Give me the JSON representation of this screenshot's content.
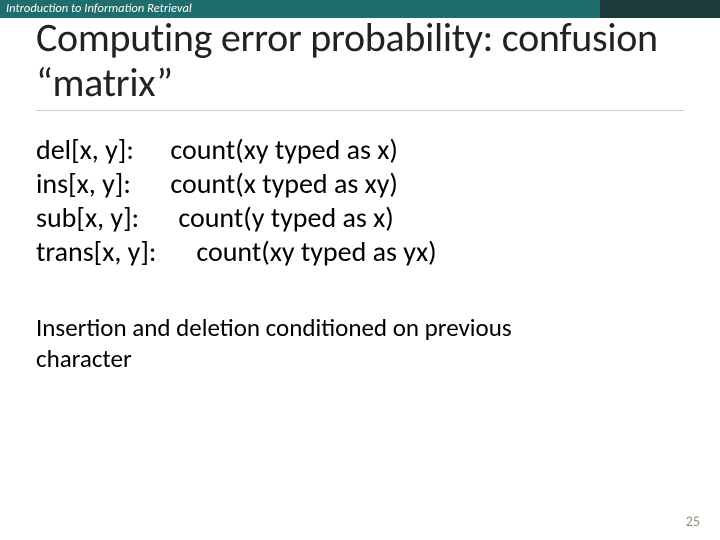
{
  "header": {
    "course_label": "Introduction to Information Retrieval"
  },
  "title": "Computing error probability: confusion “matrix”",
  "definitions": {
    "del": {
      "key": "del[x, y]:",
      "value": "count(xy typed as x)"
    },
    "ins": {
      "key": "ins[x, y]:",
      "value": "count(x typed as xy)"
    },
    "sub": {
      "key": "sub[x, y]:",
      "value": "count(y typed as x)"
    },
    "trans": {
      "key": "trans[x, y]:",
      "value": "count(xy typed as yx)"
    }
  },
  "note": "Insertion and deletion conditioned on previous character",
  "page_number": "25"
}
